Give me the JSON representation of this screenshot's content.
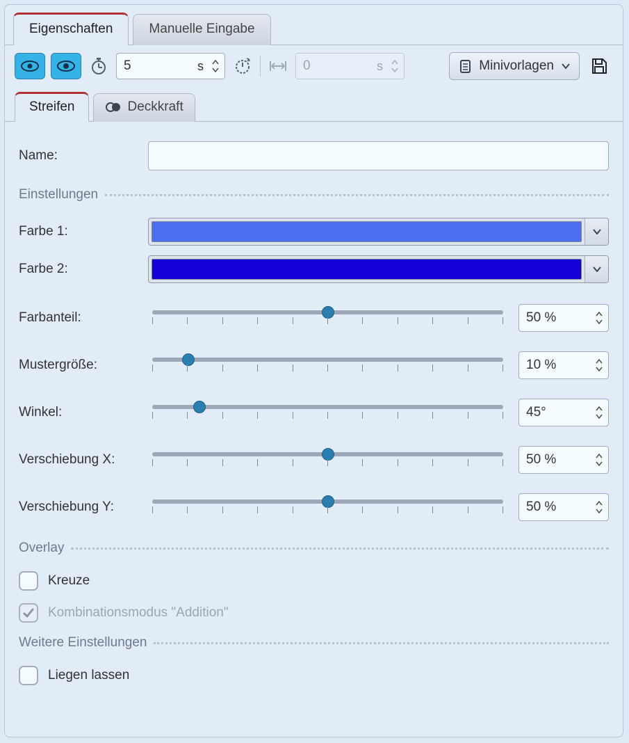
{
  "main_tabs": {
    "properties": "Eigenschaften",
    "manual": "Manuelle Eingabe"
  },
  "toolbar": {
    "duration_value": "5",
    "duration_unit": "s",
    "width_value": "0",
    "width_unit": "s",
    "templates_label": "Minivorlagen"
  },
  "sub_tabs": {
    "stripes": "Streifen",
    "opacity": "Deckkraft"
  },
  "form": {
    "name_label": "Name:",
    "name_value": ""
  },
  "sections": {
    "settings": "Einstellungen",
    "overlay": "Overlay",
    "more": "Weitere Einstellungen"
  },
  "colors": {
    "color1_label": "Farbe 1:",
    "color1_hex": "#4b6ff2",
    "color2_label": "Farbe 2:",
    "color2_hex": "#1400d8"
  },
  "sliders": {
    "farbanteil": {
      "label": "Farbanteil:",
      "value": "50 %",
      "pos": 50
    },
    "mustergroesse": {
      "label": "Mustergröße:",
      "value": "10 %",
      "pos": 11
    },
    "winkel": {
      "label": "Winkel:",
      "value": "45°",
      "pos": 14
    },
    "versch_x": {
      "label": "Verschiebung X:",
      "value": "50 %",
      "pos": 50
    },
    "versch_y": {
      "label": "Verschiebung Y:",
      "value": "50 %",
      "pos": 50
    }
  },
  "overlay": {
    "kreuze": "Kreuze",
    "addition": "Kombinationsmodus \"Addition\""
  },
  "more": {
    "liegen": "Liegen lassen"
  }
}
